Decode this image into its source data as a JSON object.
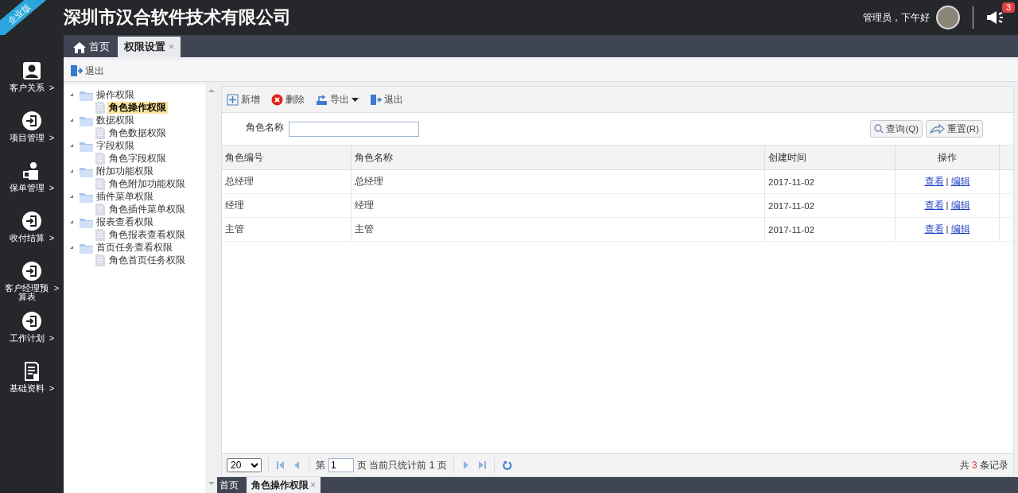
{
  "brand": {
    "ribbon": "企业版",
    "title": "深圳市汉合软件技术有限公司"
  },
  "user": {
    "greeting": "管理员，下午好",
    "notifications": "3"
  },
  "sidebar": {
    "items": [
      {
        "label": "客户关系",
        "arrow": ">",
        "kind": "person"
      },
      {
        "label": "项目管理",
        "arrow": ">",
        "kind": "enter"
      },
      {
        "label": "保单管理",
        "arrow": ">",
        "kind": "worker"
      },
      {
        "label": "收付结算",
        "arrow": ">",
        "kind": "enter"
      },
      {
        "label": "客户经理预算表",
        "arrow": ">",
        "kind": "enter"
      },
      {
        "label": "工作计划",
        "arrow": ">",
        "kind": "enter"
      },
      {
        "label": "基础资料",
        "arrow": ">",
        "kind": "document"
      }
    ]
  },
  "tabs": [
    {
      "label": "首页",
      "selected": false,
      "kind": "home"
    },
    {
      "label": "权限设置",
      "selected": true,
      "kind": "closable",
      "close": "×"
    }
  ],
  "toolbar": {
    "exit": "退出"
  },
  "tree": [
    {
      "label": "操作权限",
      "expanded": true,
      "children": [
        {
          "label": "角色操作权限",
          "selected": true
        }
      ]
    },
    {
      "label": "数据权限",
      "expanded": true,
      "children": [
        {
          "label": "角色数据权限",
          "selected": false
        }
      ]
    },
    {
      "label": "字段权限",
      "expanded": true,
      "children": [
        {
          "label": "角色字段权限",
          "selected": false
        }
      ]
    },
    {
      "label": "附加功能权限",
      "expanded": true,
      "children": [
        {
          "label": "角色附加功能权限",
          "selected": false
        }
      ]
    },
    {
      "label": "插件菜单权限",
      "expanded": true,
      "children": [
        {
          "label": "角色插件菜单权限",
          "selected": false
        }
      ]
    },
    {
      "label": "报表查看权限",
      "expanded": true,
      "children": [
        {
          "label": "角色报表查看权限",
          "selected": false
        }
      ]
    },
    {
      "label": "首页任务查看权限",
      "expanded": true,
      "children": [
        {
          "label": "角色首页任务权限",
          "selected": false
        }
      ]
    }
  ],
  "grid_toolbar": [
    {
      "kind": "add",
      "label": "新增"
    },
    {
      "kind": "delete",
      "label": "删除"
    },
    {
      "kind": "export",
      "label": "导出"
    },
    {
      "kind": "exit",
      "label": "退出"
    }
  ],
  "search": {
    "label": "角色名称",
    "query": "查询(Q)",
    "reset": "重置(R)"
  },
  "table": {
    "columns": [
      "角色编号",
      "角色名称",
      "创建时间",
      "操作"
    ],
    "rows": [
      {
        "cells": [
          "总经理",
          "总经理",
          "2017-11-02"
        ],
        "actions": [
          "查看",
          "编辑"
        ],
        "separator": "|"
      },
      {
        "cells": [
          "经理",
          "经理",
          "2017-11-02"
        ],
        "actions": [
          "查看",
          "编辑"
        ],
        "separator": "|"
      },
      {
        "cells": [
          "主管",
          "主管",
          "2017-11-02"
        ],
        "actions": [
          "查看",
          "编辑"
        ],
        "separator": "|"
      }
    ]
  },
  "pager": {
    "page_size": "20",
    "page_prefix": "第",
    "page": "1",
    "page_suffix": "页 当前只统计前 1 页",
    "total_prefix": "共",
    "total": "3",
    "total_suffix": "条记录"
  },
  "bottom_tabs": [
    {
      "label": "首页",
      "selected": false
    },
    {
      "label": "角色操作权限",
      "selected": true,
      "close": "×"
    }
  ]
}
